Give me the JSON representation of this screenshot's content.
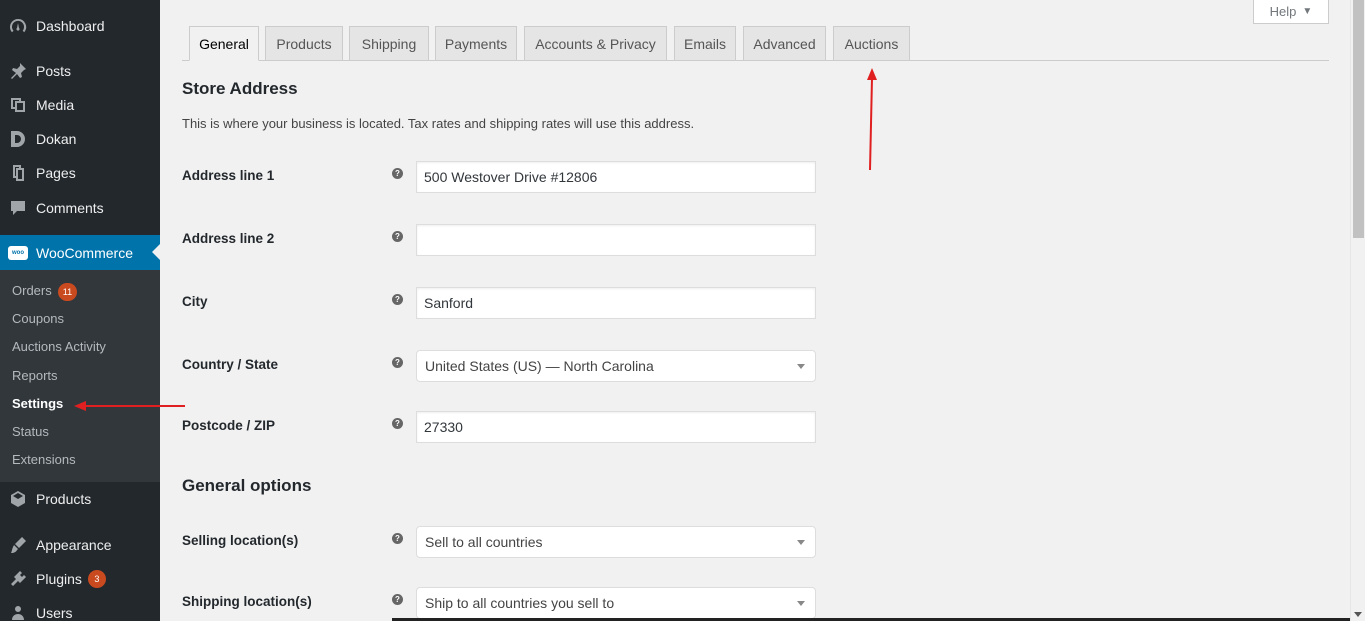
{
  "sidebar": {
    "menu": [
      {
        "label": "Dashboard",
        "icon": "dashboard-icon"
      },
      {
        "label": "Posts",
        "icon": "pin-icon"
      },
      {
        "label": "Media",
        "icon": "media-icon"
      },
      {
        "label": "Dokan",
        "icon": "dokan-icon"
      },
      {
        "label": "Pages",
        "icon": "pages-icon"
      },
      {
        "label": "Comments",
        "icon": "comments-icon"
      },
      {
        "label": "WooCommerce",
        "icon": "woocommerce-icon",
        "logo_text": "woo",
        "active": true
      },
      {
        "label": "Products",
        "icon": "products-icon"
      },
      {
        "label": "Appearance",
        "icon": "appearance-icon"
      },
      {
        "label": "Plugins",
        "icon": "plugins-icon",
        "badge": "3"
      },
      {
        "label": "Users",
        "icon": "users-icon"
      }
    ],
    "submenu": [
      {
        "label": "Orders",
        "badge": "11"
      },
      {
        "label": "Coupons"
      },
      {
        "label": "Auctions Activity"
      },
      {
        "label": "Reports"
      },
      {
        "label": "Settings",
        "current": true
      },
      {
        "label": "Status"
      },
      {
        "label": "Extensions"
      }
    ]
  },
  "help": {
    "label": "Help"
  },
  "tabs": [
    {
      "label": "General",
      "active": true
    },
    {
      "label": "Products"
    },
    {
      "label": "Shipping"
    },
    {
      "label": "Payments"
    },
    {
      "label": "Accounts & Privacy"
    },
    {
      "label": "Emails"
    },
    {
      "label": "Advanced"
    },
    {
      "label": "Auctions"
    }
  ],
  "store_address": {
    "title": "Store Address",
    "description": "This is where your business is located. Tax rates and shipping rates will use this address.",
    "fields": [
      {
        "label": "Address line 1",
        "type": "text",
        "value": "500 Westover Drive #12806"
      },
      {
        "label": "Address line 2",
        "type": "text",
        "value": ""
      },
      {
        "label": "City",
        "type": "text",
        "value": "Sanford"
      },
      {
        "label": "Country / State",
        "type": "select",
        "value": "United States (US) — North Carolina"
      },
      {
        "label": "Postcode / ZIP",
        "type": "text",
        "value": "27330"
      }
    ]
  },
  "general_options": {
    "title": "General options",
    "fields": [
      {
        "label": "Selling location(s)",
        "type": "select",
        "value": "Sell to all countries"
      },
      {
        "label": "Shipping location(s)",
        "type": "select",
        "value": "Ship to all countries you sell to"
      }
    ]
  },
  "help_tip_glyph": "?",
  "colors": {
    "sidebar_bg": "#23282d",
    "submenu_bg": "#32373c",
    "accent": "#0073aa",
    "badge": "#ca4a1f",
    "annotation_arrow": "#e02020"
  }
}
